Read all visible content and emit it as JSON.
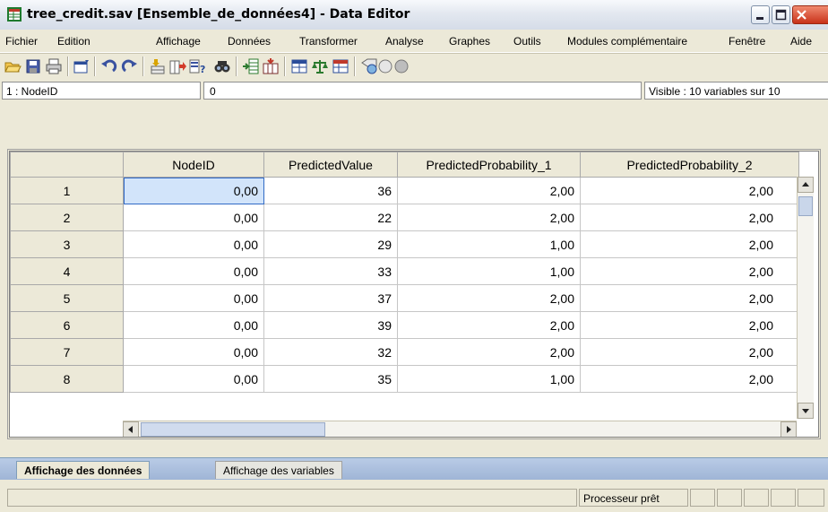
{
  "window": {
    "title": "tree_credit.sav [Ensemble_de_données4] - Data Editor",
    "controls": {
      "minimize_icon": "minimize-icon",
      "maximize_icon": "maximize-icon",
      "close_icon": "close-icon"
    }
  },
  "menu": {
    "items": [
      "Fichier",
      "Edition",
      "Affichage",
      "Données",
      "Transformer",
      "Analyse",
      "Graphes",
      "Outils",
      "Modules complémentaire",
      "Fenêtre",
      "Aide"
    ]
  },
  "toolbar": {
    "icons": [
      "open-icon",
      "save-icon",
      "print-icon",
      "dialog-recall-icon",
      "undo-icon",
      "redo-icon",
      "goto-case-icon",
      "goto-variable-icon",
      "variables-icon",
      "find-icon",
      "insert-cases-icon",
      "insert-variable-icon",
      "split-file-icon",
      "weight-cases-icon",
      "select-cases-icon",
      "value-labels-icon",
      "use-sets-icon",
      "show-all-variables-icon"
    ]
  },
  "cellbar": {
    "cell_ref": "1 : NodeID",
    "cell_value": "0",
    "visible_info": "Visible : 10 variables sur 10"
  },
  "grid": {
    "columns": [
      "NodeID",
      "PredictedValue",
      "PredictedProbability_1",
      "PredictedProbability_2"
    ],
    "rows": [
      {
        "n": "1",
        "cells": [
          "0,00",
          "36",
          "2,00",
          "2,00"
        ]
      },
      {
        "n": "2",
        "cells": [
          "0,00",
          "22",
          "2,00",
          "2,00"
        ]
      },
      {
        "n": "3",
        "cells": [
          "0,00",
          "29",
          "1,00",
          "2,00"
        ]
      },
      {
        "n": "4",
        "cells": [
          "0,00",
          "33",
          "1,00",
          "2,00"
        ]
      },
      {
        "n": "5",
        "cells": [
          "0,00",
          "37",
          "2,00",
          "2,00"
        ]
      },
      {
        "n": "6",
        "cells": [
          "0,00",
          "39",
          "2,00",
          "2,00"
        ]
      },
      {
        "n": "7",
        "cells": [
          "0,00",
          "32",
          "2,00",
          "2,00"
        ]
      },
      {
        "n": "8",
        "cells": [
          "0,00",
          "35",
          "1,00",
          "2,00"
        ]
      }
    ]
  },
  "tabs": {
    "data_view": "Affichage des données",
    "variable_view": "Affichage des variables"
  },
  "status": {
    "processor": "Processeur prêt"
  }
}
